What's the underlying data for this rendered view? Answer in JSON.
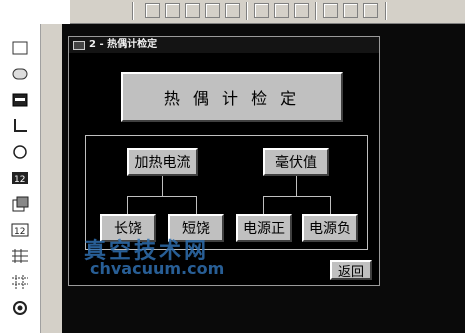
{
  "window": {
    "title": "2 - 热偶计检定"
  },
  "main_title": "热 偶 计 检 定",
  "buttons": {
    "heating_current": "加热电流",
    "millivolt": "毫伏值",
    "long_save": "长饶",
    "short_save": "短饶",
    "power_pos": "电源正",
    "power_neg": "电源负",
    "back": "返回"
  },
  "watermark": {
    "cn": "真空技术网",
    "en": "chvacuum.com"
  },
  "palette_icons": [
    "rectangle-icon",
    "ellipse-tool-icon",
    "filled-rect-icon",
    "corner-line-icon",
    "circle-icon",
    "numeric-display-icon",
    "copy-icon",
    "numeric-display2-icon",
    "pattern-icon",
    "grid-pattern-icon",
    "target-icon"
  ],
  "colors": {
    "button_face": "#c0c0c0",
    "workspace": "#0a0a0a",
    "watermark": "#2f6fb0"
  }
}
